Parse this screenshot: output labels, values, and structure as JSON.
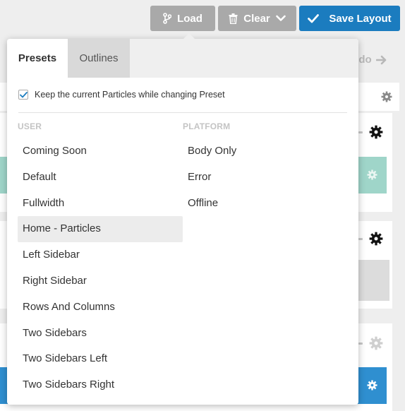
{
  "toolbar": {
    "load_label": "Load",
    "clear_label": "Clear",
    "save_label": "Save Layout"
  },
  "background": {
    "redo_label": "edo"
  },
  "popover": {
    "tabs": [
      {
        "label": "Presets",
        "active": true
      },
      {
        "label": "Outlines",
        "active": false
      }
    ],
    "keep_particles": {
      "label": "Keep the current Particles while changing Preset",
      "checked": true
    },
    "user": {
      "title": "USER",
      "items": [
        "Coming Soon",
        "Default",
        "Fullwidth",
        "Home - Particles",
        "Left Sidebar",
        "Right Sidebar",
        "Rows And Columns",
        "Two Sidebars",
        "Two Sidebars Left",
        "Two Sidebars Right"
      ],
      "highlighted": "Home - Particles"
    },
    "platform": {
      "title": "PLATFORM",
      "items": [
        "Body Only",
        "Error",
        "Offline"
      ]
    }
  },
  "colors": {
    "primary": "#1b7cbf",
    "button_gray": "#a9a9a9",
    "teal": "#9fd5c9",
    "check": "#1b7cbf"
  },
  "icons": {
    "load": "branch-icon",
    "clear": "trash-icon",
    "clear_dropdown": "chevron-down-icon",
    "save": "check-icon",
    "redo": "arrow-right-icon",
    "settings": "gear-icon"
  }
}
